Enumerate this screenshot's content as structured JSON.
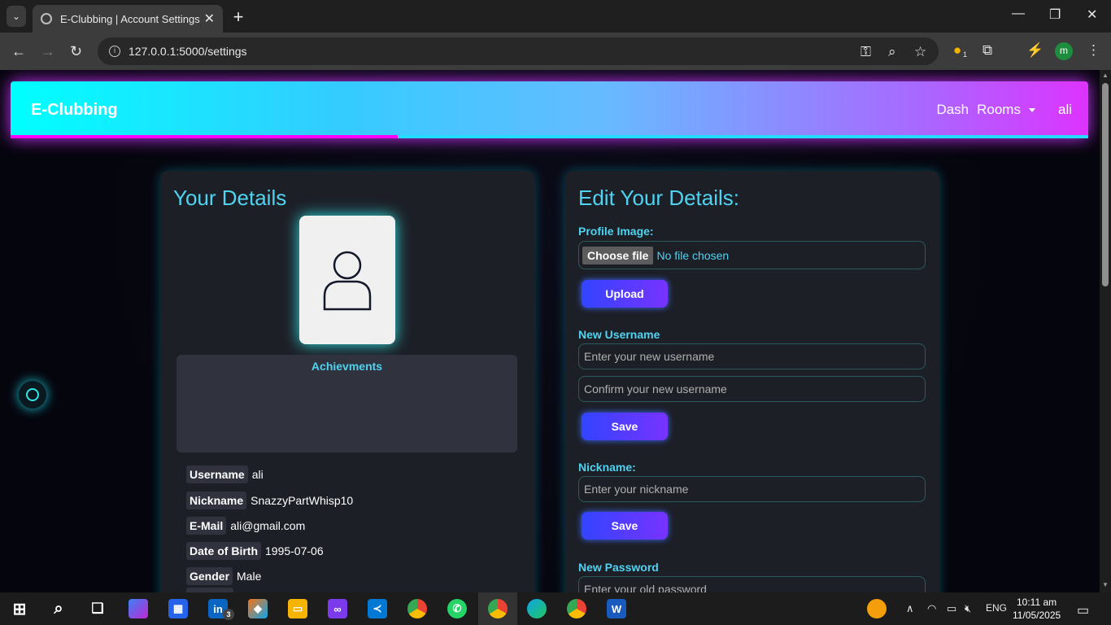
{
  "browser": {
    "tab_title": "E-Clubbing | Account Settings",
    "url": "127.0.0.1:5000/settings",
    "profile_initial": "m",
    "ext_badge": "1"
  },
  "navbar": {
    "brand": "E-Clubbing",
    "links": {
      "dash": "Dash",
      "rooms": "Rooms",
      "user": "ali"
    }
  },
  "details": {
    "title": "Your Details",
    "achievements_title": "Achievments",
    "rows": [
      {
        "key": "Username",
        "value": "ali"
      },
      {
        "key": "Nickname",
        "value": "SnazzyPartWhisp10"
      },
      {
        "key": "E-Mail",
        "value": "ali@gmail.com"
      },
      {
        "key": "Date of Birth",
        "value": "1995-07-06"
      },
      {
        "key": "Gender",
        "value": "Male"
      }
    ]
  },
  "edit": {
    "title": "Edit Your Details:",
    "profile_image_label": "Profile Image:",
    "choose_file": "Choose file",
    "no_file": "No file chosen",
    "upload": "Upload",
    "new_username_label": "New Username",
    "new_username_placeholder": "Enter your new username",
    "confirm_username_placeholder": "Confirm your new username",
    "save": "Save",
    "nickname_label": "Nickname:",
    "nickname_placeholder": "Enter your nickname",
    "new_password_label": "New Password",
    "old_password_placeholder": "Enter your old password"
  },
  "taskbar": {
    "linkedin_badge": "3",
    "lang": "ENG",
    "time": "10:11 am",
    "date": "11/05/2025"
  }
}
